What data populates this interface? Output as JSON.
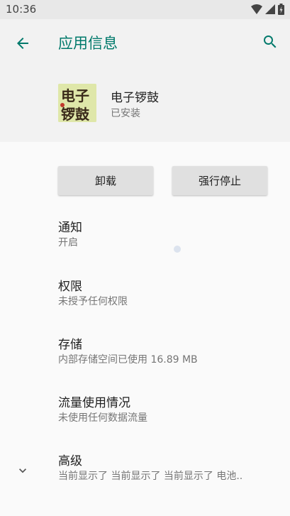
{
  "status_bar": {
    "time": "10:36"
  },
  "header": {
    "title": "应用信息"
  },
  "app": {
    "name": "电子锣鼓",
    "status": "已安装",
    "icon_text_top": "电子",
    "icon_text_bottom": "锣鼓"
  },
  "buttons": {
    "uninstall": "卸载",
    "force_stop": "强行停止"
  },
  "items": [
    {
      "title": "通知",
      "summary": "开启"
    },
    {
      "title": "权限",
      "summary": "未授予任何权限"
    },
    {
      "title": "存储",
      "summary": "内部存储空间已使用 16.89 MB"
    },
    {
      "title": "流量使用情况",
      "summary": "未使用任何数据流量"
    },
    {
      "title": "高级",
      "summary": "当前显示了 当前显示了 当前显示了 电池.."
    }
  ],
  "colors": {
    "accent": "#00796b",
    "header_bg": "#f2f2f2",
    "status_bar_bg": "#e8e8e8"
  }
}
